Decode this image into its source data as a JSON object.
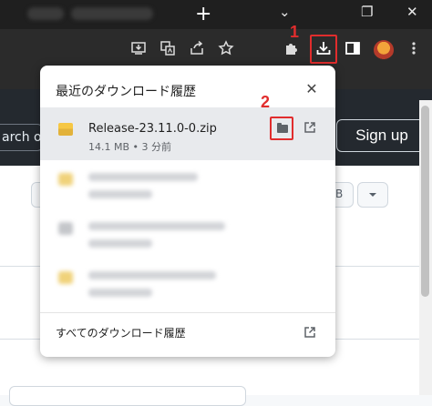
{
  "colors": {
    "annotation_red": "#e12d2d",
    "popup_bg": "#ffffff",
    "active_row_bg": "#e8eaed",
    "chrome_dark": "#2b2b2b"
  },
  "annotations": {
    "download_badge": "1",
    "folder_badge": "2"
  },
  "tabbar": {
    "new_tab_label": "+",
    "minimize_label": "⌄",
    "restore_label": "❐",
    "close_label": "✕"
  },
  "toolbar": {
    "icons": [
      "install-app-icon",
      "translate-icon",
      "share-icon",
      "bookmark-star-icon",
      "extensions-icon",
      "download-icon",
      "side-panel-icon",
      "profile-avatar",
      "menu-icon"
    ]
  },
  "page": {
    "search_fragment": "arch or",
    "signup_label": "Sign up",
    "dropdown_fragment": "B"
  },
  "downloads_popup": {
    "title": "最近のダウンロード履歴",
    "close_label": "✕",
    "items": [
      {
        "file_name": "Release-23.11.0-0.zip",
        "meta": "14.1 MB • 3 分前"
      }
    ],
    "show_all_label": "すべてのダウンロード履歴"
  }
}
